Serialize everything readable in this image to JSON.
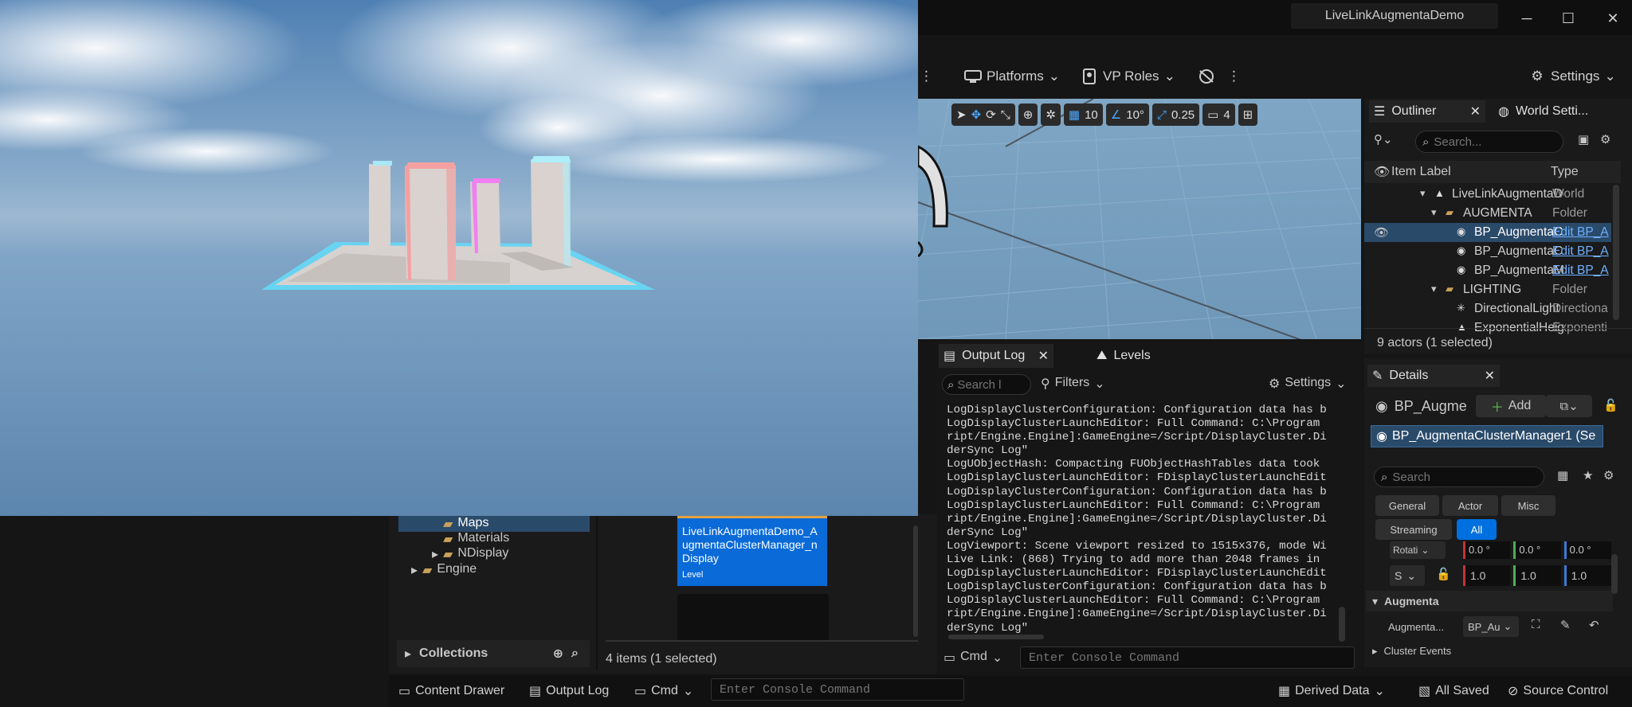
{
  "window": {
    "title": "LiveLinkAugmentaDemo"
  },
  "toolbar": {
    "platforms": "Platforms",
    "vp_roles": "VP Roles",
    "settings": "Settings"
  },
  "viewport": {
    "grid": "10",
    "angle": "10°",
    "scale": "0.25",
    "camera_speed": "4"
  },
  "outliner": {
    "tab": "Outliner",
    "tab2": "World Setti...",
    "search_placeholder": "Search...",
    "col_label": "Item Label",
    "col_type": "Type",
    "rows": [
      {
        "label": "LiveLinkAugmentaDe",
        "type": "World"
      },
      {
        "label": "AUGMENTA",
        "type": "Folder"
      },
      {
        "label": "BP_AugmentaCl",
        "type": "Edit BP_A"
      },
      {
        "label": "BP_AugmentaCl",
        "type": "Edit BP_A"
      },
      {
        "label": "BP_AugmentaMa",
        "type": "Edit BP_A"
      },
      {
        "label": "LIGHTING",
        "type": "Folder"
      },
      {
        "label": "DirectionalLight",
        "type": "Directiona"
      },
      {
        "label": "ExponentialHeigh",
        "type": "Exponenti"
      }
    ],
    "footer": "9 actors (1 selected)"
  },
  "details": {
    "tab": "Details",
    "name": "BP_Augme",
    "add": "Add",
    "component": "BP_AugmentaClusterManager1 (Se",
    "search_placeholder": "Search",
    "filters": [
      "General",
      "Actor",
      "Misc",
      "Streaming",
      "All"
    ],
    "rotation_label": "Rotati",
    "rotation": [
      "0.0 °",
      "0.0 °",
      "0.0 °"
    ],
    "scale_label": "S",
    "scale": [
      "1.0",
      "1.0",
      "1.0"
    ],
    "section": "Augmenta",
    "prop_label": "Augmenta...",
    "prop_value": "BP_Au",
    "cluster_events": "Cluster Events"
  },
  "output_log": {
    "tab": "Output Log",
    "tab2": "Levels",
    "search_placeholder": "Search l",
    "filters": "Filters",
    "settings": "Settings",
    "lines": [
      "LogDisplayClusterConfiguration: Configuration data has b",
      "LogDisplayClusterLaunchEditor: Full Command: C:\\Program",
      "ript/Engine.Engine]:GameEngine=/Script/DisplayCluster.Di",
      "derSync Log\"",
      "LogUObjectHash: Compacting FUObjectHashTables data took",
      "LogDisplayClusterLaunchEditor: FDisplayClusterLaunchEdit",
      "LogDisplayClusterConfiguration: Configuration data has b",
      "LogDisplayClusterLaunchEditor: Full Command: C:\\Program",
      "ript/Engine.Engine]:GameEngine=/Script/DisplayCluster.Di",
      "derSync Log\"",
      "LogViewport: Scene viewport resized to 1515x376, mode Wi",
      "Live Link: (868) Trying to add more than 2048 frames in",
      "LogDisplayClusterLaunchEditor: FDisplayClusterLaunchEdit",
      "LogDisplayClusterConfiguration: Configuration data has b",
      "LogDisplayClusterLaunchEditor: Full Command: C:\\Program",
      "ript/Engine.Engine]:GameEngine=/Script/DisplayCluster.Di",
      "derSync Log\""
    ],
    "cmd": "Cmd",
    "console_placeholder": "Enter Console Command"
  },
  "content": {
    "tree": [
      "Maps",
      "Materials",
      "NDisplay",
      "Engine"
    ],
    "collections": "Collections",
    "asset_name": "LiveLinkAugmentaDemo_AugmentaClusterManager_nDisplay",
    "asset_type": "Level",
    "status": "4 items (1 selected)"
  },
  "bottombar": {
    "content_drawer": "Content Drawer",
    "output_log": "Output Log",
    "cmd": "Cmd",
    "console_placeholder": "Enter Console Command",
    "derived_data": "Derived Data",
    "all_saved": "All Saved",
    "source_control": "Source Control"
  },
  "colors": {
    "accent": "#0070e0",
    "selection": "#2a4a6a",
    "panel": "#1a1a1a"
  }
}
